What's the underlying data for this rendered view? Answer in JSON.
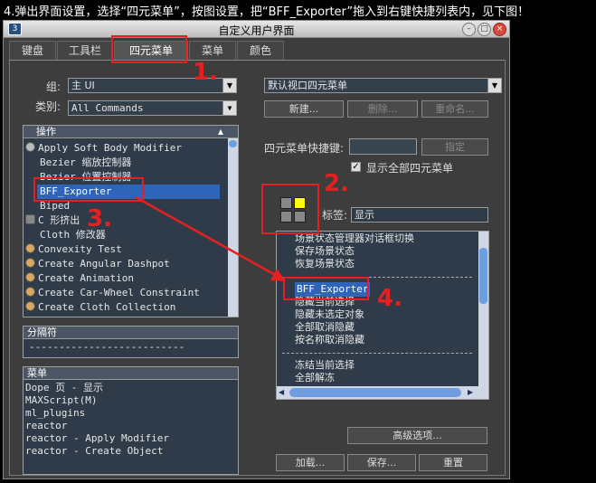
{
  "caption": "4.弹出界面设置，选择“四元菜单”，按图设置，把“BFF_Exporter”拖入到右键快捷列表内，见下图！",
  "window": {
    "title": "自定义用户界面",
    "app_icon": "3",
    "minimize": "–",
    "maximize": "□",
    "close": "×"
  },
  "tabs": [
    "键盘",
    "工具栏",
    "四元菜单",
    "菜单",
    "颜色"
  ],
  "left": {
    "group_label": "组:",
    "group_value": "主 UI",
    "category_label": "类别:",
    "category_value": "All Commands",
    "actions_header": "操作",
    "actions": [
      "Apply Soft Body Modifier",
      "Bezier 缩放控制器",
      "Bezier 位置控制器",
      "BFF_Exporter",
      "Biped",
      "C 形挤出",
      "Cloth 修改器",
      "Convexity Test",
      "Create Angular Dashpot",
      "Create Animation",
      "Create Car-Wheel Constraint",
      "Create Cloth Collection"
    ],
    "separator_header": "分隔符",
    "separator_item": "--------------------------",
    "menus_header": "菜单",
    "menus": [
      "Dope 页 - 显示",
      "MAXScript(M)",
      "ml_plugins",
      "reactor",
      "reactor - Apply Modifier",
      "reactor - Create Object"
    ]
  },
  "right": {
    "quad_value": "默认视口四元菜单",
    "new_btn": "新建...",
    "delete_btn": "删除...",
    "rename_btn": "重命名...",
    "shortcut_label": "四元菜单快捷键:",
    "shortcut_value": "",
    "assign_btn": "指定",
    "show_all_label": "显示全部四元菜单",
    "show_all_checked": true,
    "label_label": "标签:",
    "label_value": "显示",
    "items": [
      "场景状态管理器对话框切换",
      "保存场景状态",
      "恢复场景状态",
      "",
      "BFF_Exporter",
      "隐藏当前选择",
      "隐藏未选定对象",
      "全部取消隐藏",
      "按名称取消隐藏",
      "",
      "冻结当前选择",
      "全部解冻"
    ],
    "advanced_btn": "高级选项...",
    "load_btn": "加载...",
    "save_btn": "保存...",
    "reset_btn": "重置"
  },
  "annotations": [
    "1.",
    "2.",
    "3.",
    "4."
  ],
  "colors": {
    "quad_highlight": "#ffff00",
    "annotation_red": "#e62020",
    "selection": "#2e65b8"
  }
}
